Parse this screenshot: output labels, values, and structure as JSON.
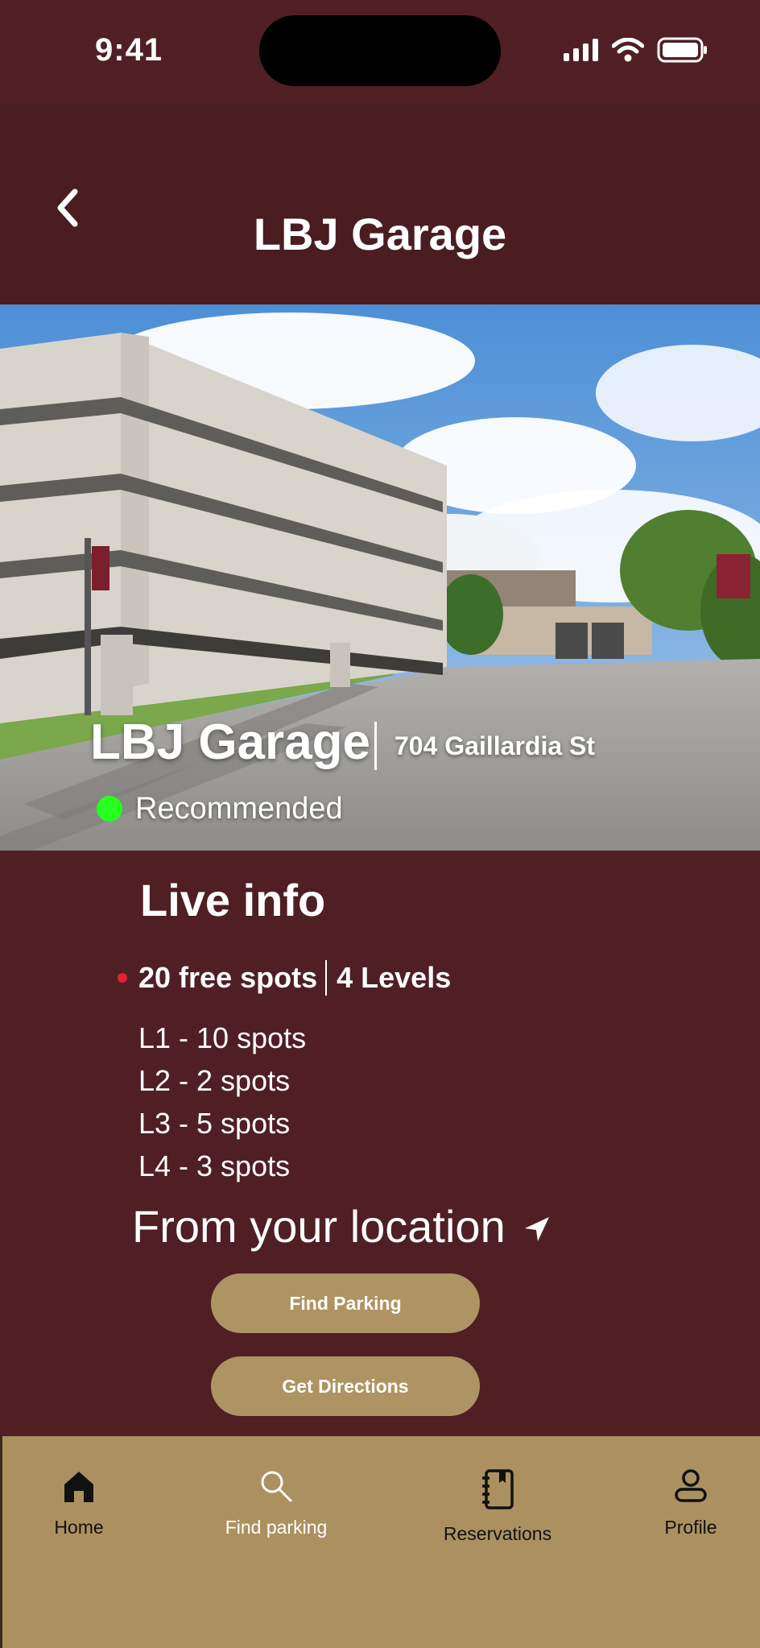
{
  "status_bar": {
    "time": "9:41"
  },
  "header": {
    "title": "LBJ Garage"
  },
  "hero": {
    "name": "LBJ Garage",
    "address": "704 Gaillardia St",
    "status_label": "Recommended",
    "status_color": "#27ff1f"
  },
  "live_info": {
    "title": "Live info",
    "free_spots": "20 free spots",
    "levels_summary": "4 Levels",
    "levels": [
      "L1 - 10 spots",
      "L2 - 2 spots",
      "L3 - 5 spots",
      "L4 - 3 spots"
    ]
  },
  "location": {
    "heading": "From your location"
  },
  "actions": {
    "find_parking": "Find Parking",
    "get_directions": "Get Directions"
  },
  "tab_bar": {
    "items": [
      {
        "label": "Home",
        "icon": "home-icon"
      },
      {
        "label": "Find parking",
        "icon": "search-icon"
      },
      {
        "label": "Reservations",
        "icon": "notebook-icon"
      },
      {
        "label": "Profile",
        "icon": "user-icon"
      }
    ]
  },
  "colors": {
    "background": "#4f1f24",
    "button": "#ae9462",
    "tab_bar": "#ac9160",
    "bullet": "#e0242b"
  }
}
